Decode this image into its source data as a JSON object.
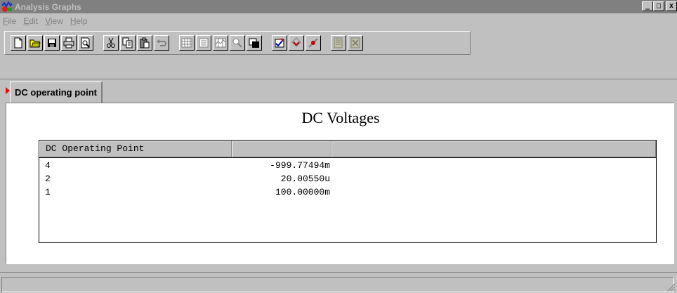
{
  "window": {
    "title": "Analysis Graphs",
    "controls": {
      "minimize": "_",
      "maximize": "□",
      "close": "x"
    }
  },
  "menu": [
    {
      "accel": "F",
      "rest": "ile"
    },
    {
      "accel": "E",
      "rest": "dit"
    },
    {
      "accel": "V",
      "rest": "iew"
    },
    {
      "accel": "H",
      "rest": "elp"
    }
  ],
  "toolbar": {
    "buttons": [
      "new-icon",
      "open-icon",
      "save-icon",
      "print-icon",
      "print-preview-icon",
      "cut-icon",
      "copy-icon",
      "paste-icon",
      "undo-icon",
      "grid-icon",
      "legend-icon",
      "cursors-icon",
      "zoom-icon",
      "reverse-colors-icon",
      "transfer-icon",
      "overlay-icon",
      "exclude-icon",
      "export-icon",
      "export-excel-icon"
    ]
  },
  "tab": {
    "label": "DC operating point"
  },
  "panel": {
    "title": "DC Voltages",
    "table": {
      "headers": [
        "DC Operating Point",
        "",
        ""
      ],
      "rows": [
        {
          "node": "4",
          "value": "-999.77494m"
        },
        {
          "node": "2",
          "value": "20.00550u"
        },
        {
          "node": "1",
          "value": "100.00000m"
        }
      ]
    }
  },
  "colors": {
    "face": "#c0c0c0",
    "titlebar_inactive": "#808080",
    "tab_marker": "#ff0000"
  }
}
